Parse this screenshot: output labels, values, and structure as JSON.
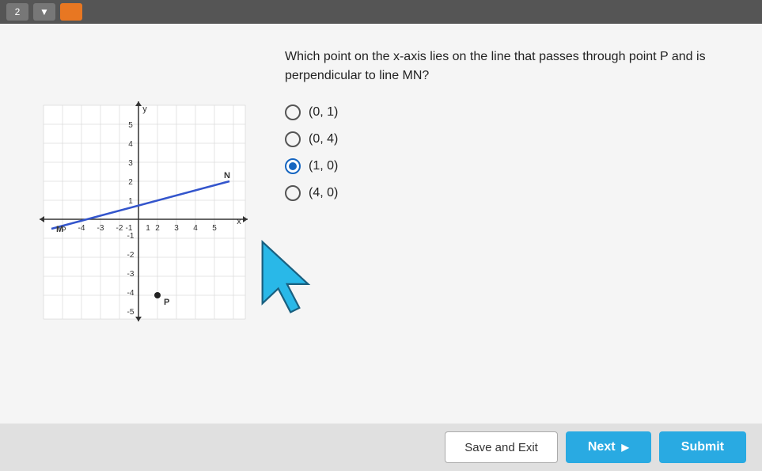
{
  "topbar": {
    "btn1": "2",
    "btn2": "▼",
    "btn3": ""
  },
  "question": {
    "text": "Which point on the x-axis lies on the line that passes through point P and is perpendicular to line MN?",
    "options": [
      {
        "id": "opt1",
        "label": "(0, 1)",
        "selected": false
      },
      {
        "id": "opt2",
        "label": "(0, 4)",
        "selected": false
      },
      {
        "id": "opt3",
        "label": "(1, 0)",
        "selected": true
      },
      {
        "id": "opt4",
        "label": "(4, 0)",
        "selected": false
      }
    ]
  },
  "buttons": {
    "save_exit": "Save and Exit",
    "next": "Next",
    "submit": "Submit"
  },
  "colors": {
    "selected_radio": "#1565c0",
    "next_btn": "#29aae2",
    "submit_btn": "#29aae2"
  }
}
